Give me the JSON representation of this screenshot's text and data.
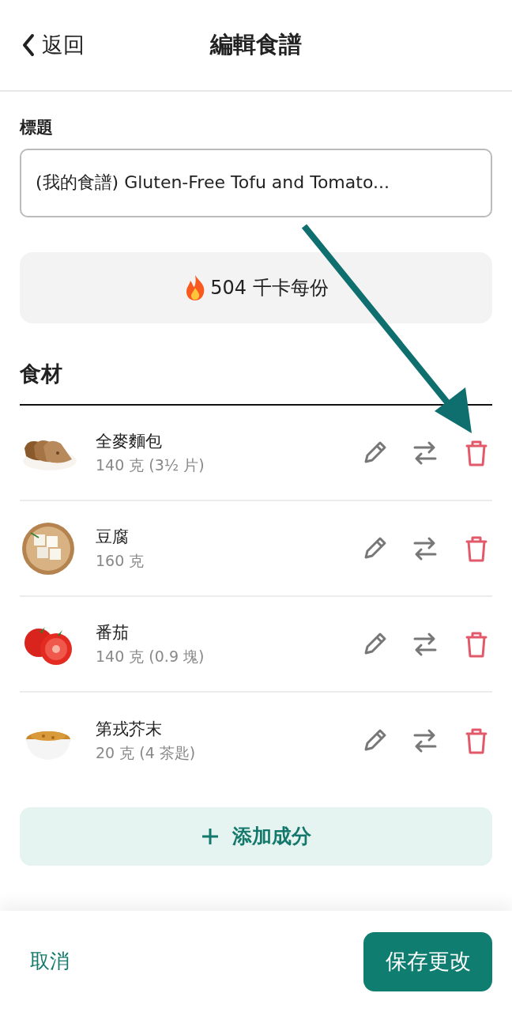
{
  "header": {
    "back": "返回",
    "title": "編輯食譜"
  },
  "title_field": {
    "label": "標題",
    "value": "(我的食譜) Gluten-Free Tofu and Tomato..."
  },
  "calories": "504 千卡每份",
  "ingredients_heading": "食材",
  "ingredients": [
    {
      "name": "全麥麵包",
      "amount": "140 克 (3½ 片)"
    },
    {
      "name": "豆腐",
      "amount": "160 克"
    },
    {
      "name": "番茄",
      "amount": "140 克 (0.9 塊)"
    },
    {
      "name": "第戎芥末",
      "amount": "20 克 (4 茶匙)"
    }
  ],
  "add_button": "添加成分",
  "footer": {
    "cancel": "取消",
    "save": "保存更改"
  },
  "annotation_arrow": true
}
